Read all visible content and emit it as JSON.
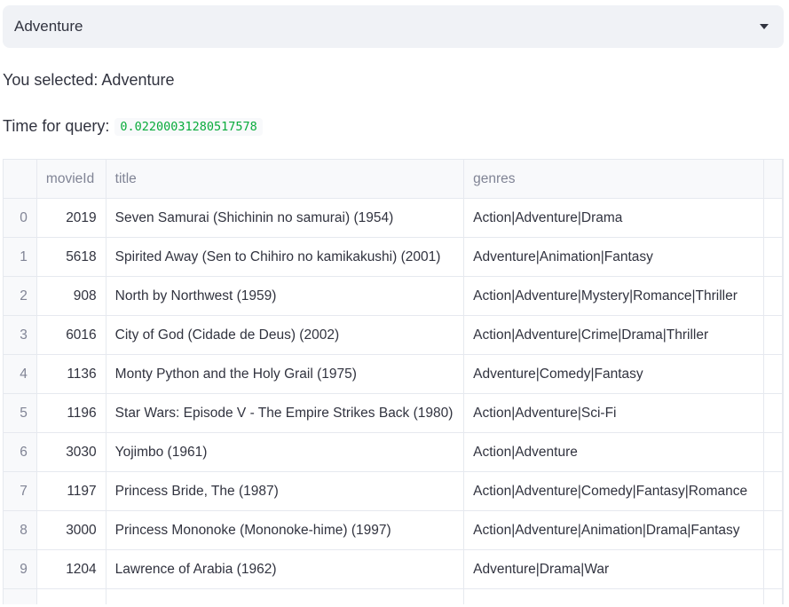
{
  "select": {
    "value": "Adventure"
  },
  "selected_text": "You selected: Adventure",
  "query": {
    "label": "Time for query:",
    "value": "0.02200031280517578"
  },
  "table": {
    "columns": [
      "",
      "movieId",
      "title",
      "genres"
    ],
    "rows": [
      [
        "0",
        "2019",
        "Seven Samurai (Shichinin no samurai) (1954)",
        "Action|Adventure|Drama"
      ],
      [
        "1",
        "5618",
        "Spirited Away (Sen to Chihiro no kamikakushi) (2001)",
        "Adventure|Animation|Fantasy"
      ],
      [
        "2",
        "908",
        "North by Northwest (1959)",
        "Action|Adventure|Mystery|Romance|Thriller"
      ],
      [
        "3",
        "6016",
        "City of God (Cidade de Deus) (2002)",
        "Action|Adventure|Crime|Drama|Thriller"
      ],
      [
        "4",
        "1136",
        "Monty Python and the Holy Grail (1975)",
        "Adventure|Comedy|Fantasy"
      ],
      [
        "5",
        "1196",
        "Star Wars: Episode V - The Empire Strikes Back (1980)",
        "Action|Adventure|Sci-Fi"
      ],
      [
        "6",
        "3030",
        "Yojimbo (1961)",
        "Action|Adventure"
      ],
      [
        "7",
        "1197",
        "Princess Bride, The (1987)",
        "Action|Adventure|Comedy|Fantasy|Romance"
      ],
      [
        "8",
        "3000",
        "Princess Mononoke (Mononoke-hime) (1997)",
        "Action|Adventure|Animation|Drama|Fantasy"
      ],
      [
        "9",
        "1204",
        "Lawrence of Arabia (1962)",
        "Adventure|Drama|War"
      ]
    ]
  }
}
